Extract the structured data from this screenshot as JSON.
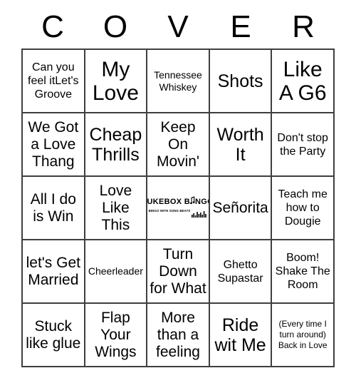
{
  "header": {
    "letters": [
      "C",
      "O",
      "V",
      "E",
      "R"
    ]
  },
  "logo": {
    "word_left": "JUKEBOX B",
    "word_right": "NG",
    "word_end": "O",
    "tagline": "BINGO WITH SONG BEATS",
    "note_icon": "music-note-icon",
    "equalizer_icon": "equalizer-icon"
  },
  "grid": {
    "rows": [
      [
        {
          "text": "Can you feel itLet's Groove",
          "size": "fs-sm"
        },
        {
          "text": "My Love",
          "size": "fs-xl"
        },
        {
          "text": "Tennessee Whiskey",
          "size": "fs-xs"
        },
        {
          "text": "Shots",
          "size": "fs-lg"
        },
        {
          "text": "Like A G6",
          "size": "fs-xl"
        }
      ],
      [
        {
          "text": "We Got a Love Thang",
          "size": "fs-md"
        },
        {
          "text": "Cheap Thrills",
          "size": "fs-lg"
        },
        {
          "text": "Keep On Movin'",
          "size": "fs-md"
        },
        {
          "text": "Worth It",
          "size": "fs-lg"
        },
        {
          "text": "Don't stop the Party",
          "size": "fs-sm"
        }
      ],
      [
        {
          "text": "All I do is Win",
          "size": "fs-md"
        },
        {
          "text": "Love Like This",
          "size": "fs-md"
        },
        {
          "text": "",
          "size": "logo"
        },
        {
          "text": "Señorita",
          "size": "fs-md"
        },
        {
          "text": "Teach me how to Dougie",
          "size": "fs-sm"
        }
      ],
      [
        {
          "text": "let's Get Married",
          "size": "fs-md"
        },
        {
          "text": "Cheerleader",
          "size": "fs-xs"
        },
        {
          "text": "Turn Down for What",
          "size": "fs-md"
        },
        {
          "text": "Ghetto Supastar",
          "size": "fs-sm"
        },
        {
          "text": "Boom! Shake The Room",
          "size": "fs-sm"
        }
      ],
      [
        {
          "text": "Stuck like glue",
          "size": "fs-md"
        },
        {
          "text": "Flap Your Wings",
          "size": "fs-md"
        },
        {
          "text": "More than a feeling",
          "size": "fs-md"
        },
        {
          "text": "Ride wit Me",
          "size": "fs-lg"
        },
        {
          "text": "(Every time I turn around) Back in Love",
          "size": "fs-xxs"
        }
      ]
    ]
  }
}
